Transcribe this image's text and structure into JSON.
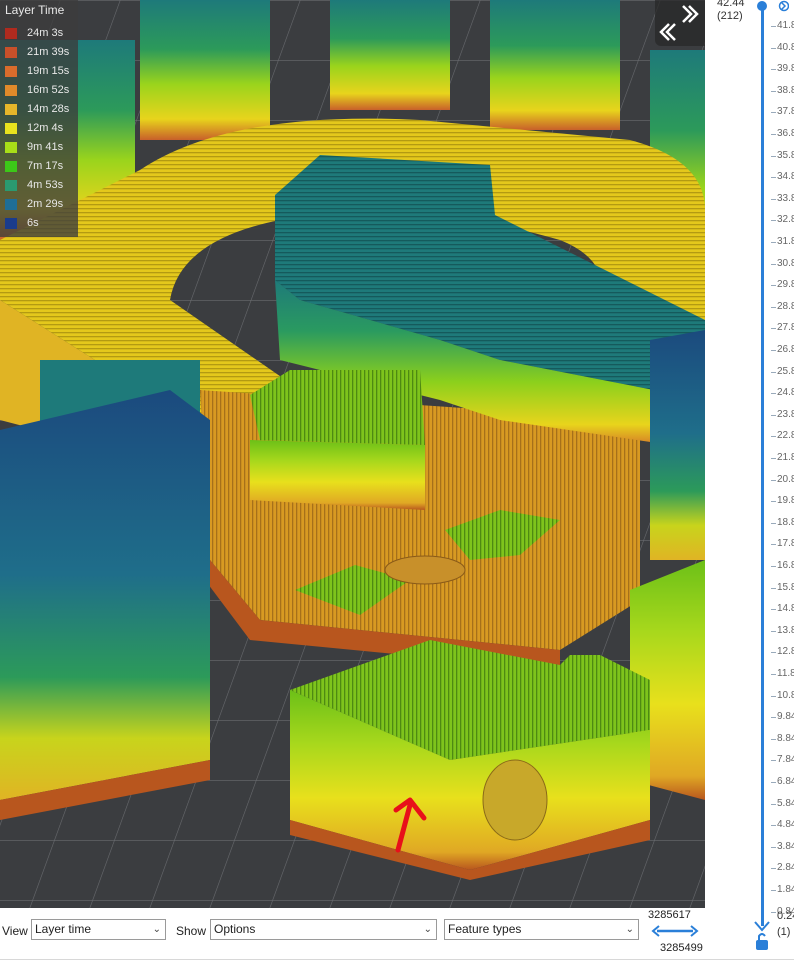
{
  "legend": {
    "title": "Layer Time",
    "items": [
      {
        "label": "24m 3s",
        "color": "#b02a1e"
      },
      {
        "label": "21m 39s",
        "color": "#c8502a"
      },
      {
        "label": "19m 15s",
        "color": "#d96c2c"
      },
      {
        "label": "16m 52s",
        "color": "#e08a2a"
      },
      {
        "label": "14m 28s",
        "color": "#e6b62a"
      },
      {
        "label": "12m 4s",
        "color": "#e8e21e"
      },
      {
        "label": "9m 41s",
        "color": "#a8de18"
      },
      {
        "label": "7m 17s",
        "color": "#3cc818"
      },
      {
        "label": "4m 53s",
        "color": "#2a9a70"
      },
      {
        "label": "2m 29s",
        "color": "#1f6e96"
      },
      {
        "label": "6s",
        "color": "#1a3c8c"
      }
    ]
  },
  "vertical_slider": {
    "top_value": "42.44",
    "top_layer": "(212)",
    "bottom_value": "0.24",
    "bottom_layer": "(1)",
    "ticks": [
      "41.8",
      "40.8",
      "39.8",
      "38.8",
      "37.8",
      "36.8",
      "35.8",
      "34.8",
      "33.8",
      "32.8",
      "31.8",
      "30.8",
      "29.8",
      "28.8",
      "27.8",
      "26.8",
      "25.8",
      "24.8",
      "23.8",
      "22.8",
      "21.8",
      "20.8",
      "19.8",
      "18.8",
      "17.8",
      "16.8",
      "15.8",
      "14.8",
      "13.8",
      "12.8",
      "11.8",
      "10.8",
      "9.84",
      "8.84",
      "7.84",
      "6.84",
      "5.84",
      "4.84",
      "3.84",
      "2.84",
      "1.84",
      "0.84"
    ]
  },
  "toolbar": {
    "view_label": "View",
    "view_value": "Layer time",
    "show_label": "Show",
    "show_value": "Options",
    "feature_value": "Feature types",
    "h_top": "3285617",
    "h_bottom": "3285499"
  },
  "colors": {
    "accent": "#2a7fd8",
    "bed": "#3b3d40"
  }
}
